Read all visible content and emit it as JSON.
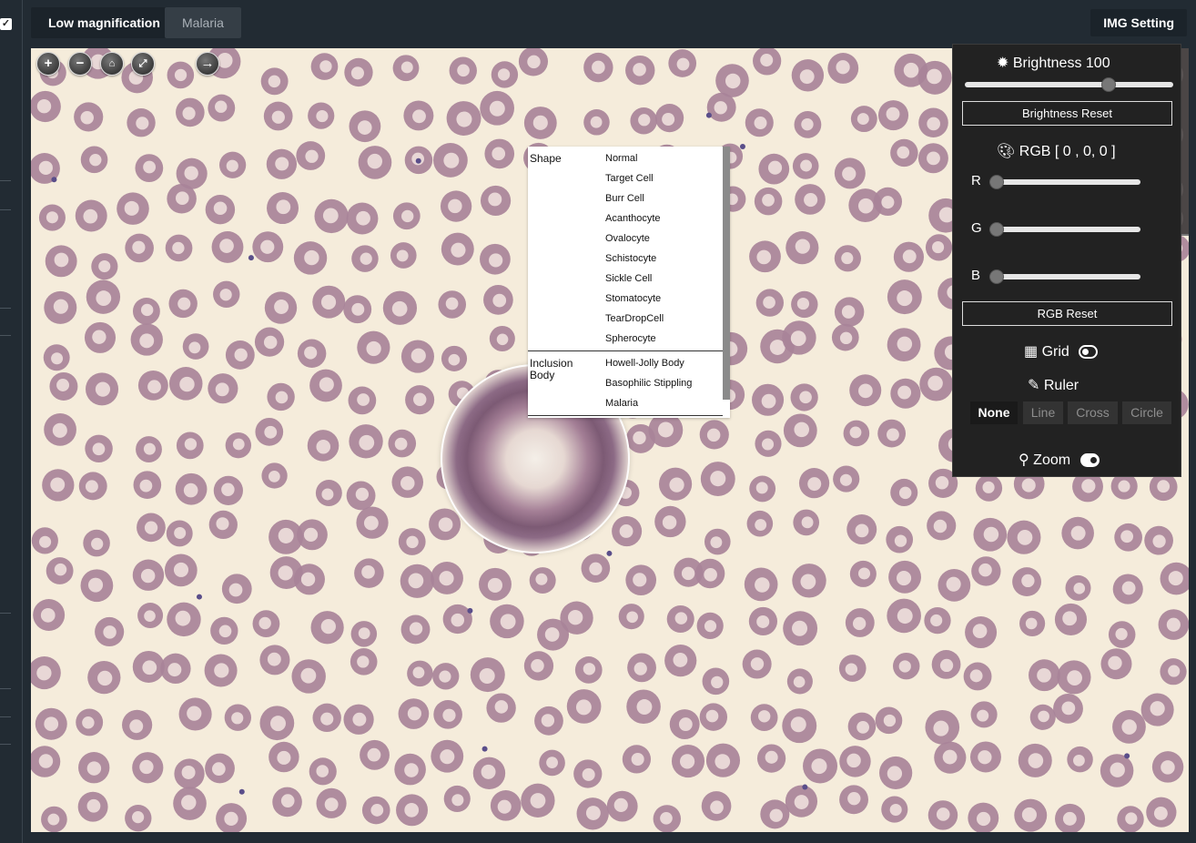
{
  "tabs": [
    {
      "label": "Low magnification",
      "active": true
    },
    {
      "label": "Malaria",
      "active": false
    }
  ],
  "header": {
    "img_setting_label": "IMG Setting"
  },
  "viewer_toolbar": {
    "zoom_in_icon": "plus-icon",
    "zoom_out_icon": "minus-icon",
    "home_icon": "home-icon",
    "fullscreen_icon": "fullscreen-icon",
    "next_icon": "arrow-right-icon"
  },
  "context_menu": {
    "groups": [
      {
        "label": "Shape",
        "items": [
          "Normal",
          "Target Cell",
          "Burr Cell",
          "Acanthocyte",
          "Ovalocyte",
          "Schistocyte",
          "Sickle Cell",
          "Stomatocyte",
          "TearDropCell",
          "Spherocyte"
        ]
      },
      {
        "label_line1": "Inclusion",
        "label_line2": "Body",
        "items": [
          "Howell-Jolly Body",
          "Basophilic Stippling",
          "Malaria"
        ]
      }
    ]
  },
  "settings": {
    "brightness_label": "Brightness 100",
    "brightness_value": 100,
    "brightness_reset": "Brightness Reset",
    "rgb_label": "RGB [ 0 , 0, 0 ]",
    "r_label": "R",
    "g_label": "G",
    "b_label": "B",
    "r_value": 0,
    "g_value": 0,
    "b_value": 0,
    "rgb_reset": "RGB Reset",
    "grid_label": "Grid",
    "grid_on": false,
    "ruler_label": "Ruler",
    "ruler_options": [
      "None",
      "Line",
      "Cross",
      "Circle"
    ],
    "ruler_selected": "None",
    "zoom_label": "Zoom",
    "zoom_on": true
  },
  "colors": {
    "background": "#222b33",
    "slide": "#f5ecdb",
    "cell": "#a27f93",
    "panel": "#222222"
  }
}
